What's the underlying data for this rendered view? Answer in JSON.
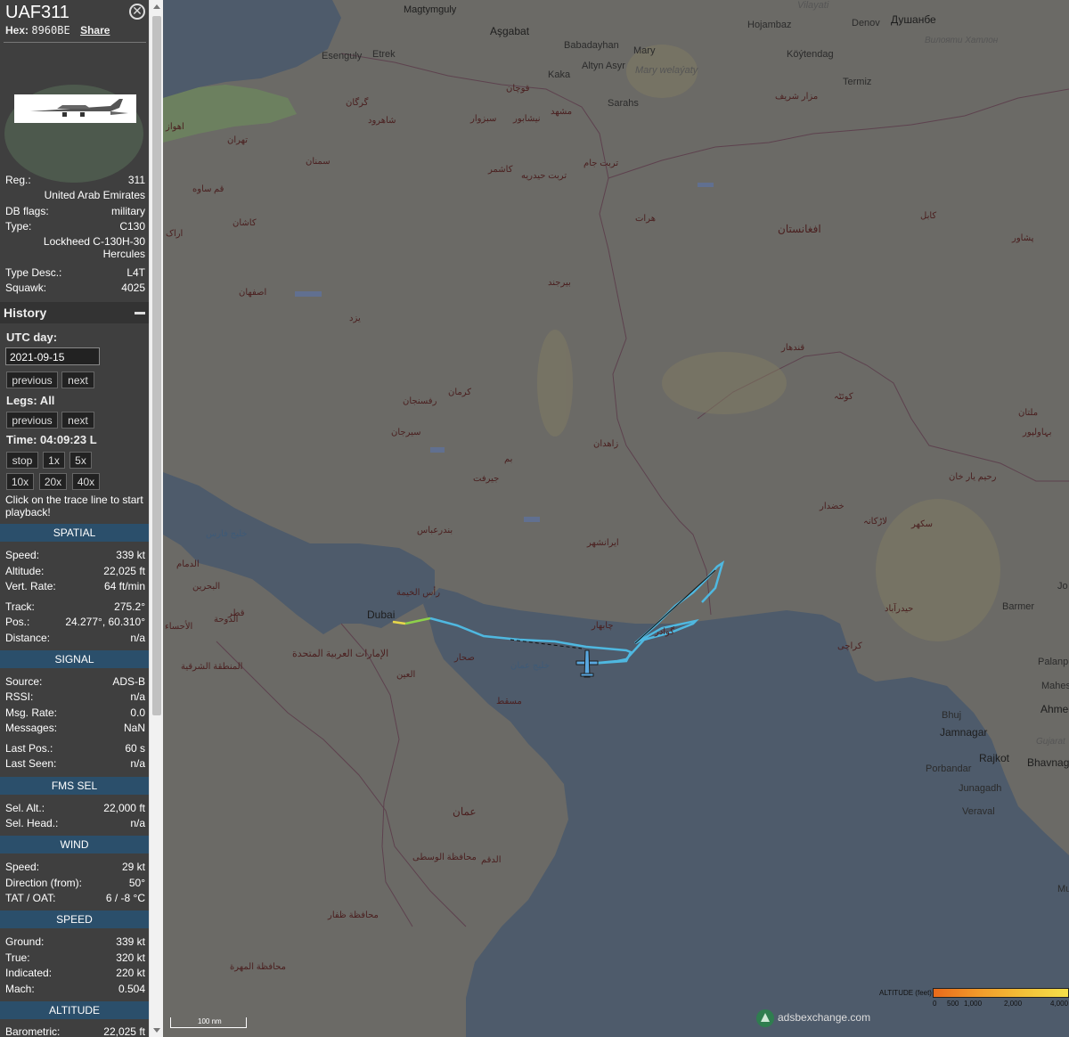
{
  "aircraft": {
    "callsign": "UAF311",
    "hex_label": "Hex:",
    "hex": "8960BE",
    "share_label": "Share",
    "close_symbol": "✕"
  },
  "info": [
    {
      "key": "Reg.:",
      "value": "311"
    },
    {
      "key": "",
      "value": "United Arab Emirates"
    },
    {
      "key": "DB flags:",
      "value": "military"
    },
    {
      "key": "Type:",
      "value": "C130"
    },
    {
      "key": "",
      "value": "Lockheed C-130H-30"
    },
    {
      "key": "",
      "value": "Hercules"
    },
    {
      "key": "Type Desc.:",
      "value": "L4T"
    },
    {
      "key": "Squawk:",
      "value": "4025"
    }
  ],
  "history": {
    "title": "History",
    "utc_day_label": "UTC day:",
    "date": "2021-09-15",
    "previous": "previous",
    "next": "next",
    "legs_label": "Legs: All",
    "time_label": "Time: 04:09:23 L",
    "stop": "stop",
    "x1": "1x",
    "x5": "5x",
    "x10": "10x",
    "x20": "20x",
    "x40": "40x",
    "note": "Click on the trace line to start playback!"
  },
  "sections": {
    "spatial": "SPATIAL",
    "signal": "SIGNAL",
    "fms": "FMS SEL",
    "wind": "WIND",
    "speed": "SPEED",
    "altitude": "ALTITUDE"
  },
  "spatial": [
    {
      "key": "Speed:",
      "value": "339 kt"
    },
    {
      "key": "Altitude:",
      "value": "22,025 ft"
    },
    {
      "key": "Vert. Rate:",
      "value": "64 ft/min"
    },
    {
      "key": "Track:",
      "value": "275.2°"
    },
    {
      "key": "Pos.:",
      "value": "24.277°, 60.310°"
    },
    {
      "key": "Distance:",
      "value": "n/a"
    }
  ],
  "signal": [
    {
      "key": "Source:",
      "value": "ADS-B"
    },
    {
      "key": "RSSI:",
      "value": "n/a"
    },
    {
      "key": "Msg. Rate:",
      "value": "0.0"
    },
    {
      "key": "Messages:",
      "value": "NaN"
    },
    {
      "key": "Last Pos.:",
      "value": "60 s"
    },
    {
      "key": "Last Seen:",
      "value": "n/a"
    }
  ],
  "fms": [
    {
      "key": "Sel. Alt.:",
      "value": "22,000 ft"
    },
    {
      "key": "Sel. Head.:",
      "value": "n/a"
    }
  ],
  "wind": [
    {
      "key": "Speed:",
      "value": "29 kt"
    },
    {
      "key": "Direction (from):",
      "value": "50°"
    },
    {
      "key": "TAT / OAT:",
      "value": "6 / -8 °C"
    }
  ],
  "speed": [
    {
      "key": "Ground:",
      "value": "339 kt"
    },
    {
      "key": "True:",
      "value": "320 kt"
    },
    {
      "key": "Indicated:",
      "value": "220 kt"
    },
    {
      "key": "Mach:",
      "value": "0.504"
    }
  ],
  "altitude": [
    {
      "key": "Barometric:",
      "value": "22,025 ft"
    }
  ],
  "map": {
    "places": [
      {
        "name": "Magtymguly"
      },
      {
        "name": "Aşgabat"
      },
      {
        "name": "Babadayhan"
      },
      {
        "name": "Mary"
      },
      {
        "name": "Altyn Asyr"
      },
      {
        "name": "Mary welaýaty"
      },
      {
        "name": "Hojambaz"
      },
      {
        "name": "Denov"
      },
      {
        "name": "Душанбе"
      },
      {
        "name": "Köýtendag"
      },
      {
        "name": "Esenguly"
      },
      {
        "name": "Etrek"
      },
      {
        "name": "Kaka"
      },
      {
        "name": "Sarahs"
      },
      {
        "name": "Termiz"
      },
      {
        "name": "Vilayati"
      },
      {
        "name": "Вилояти Хатлон"
      },
      {
        "name": "Dubai"
      },
      {
        "name": "Barmer"
      },
      {
        "name": "Palanpur"
      },
      {
        "name": "Mahesana"
      },
      {
        "name": "Ahmed"
      },
      {
        "name": "Bhuj"
      },
      {
        "name": "Jamnagar"
      },
      {
        "name": "Rajkot"
      },
      {
        "name": "Bhavnaga"
      },
      {
        "name": "Gujarat"
      },
      {
        "name": "Porbandar"
      },
      {
        "name": "Junagadh"
      },
      {
        "name": "Veraval"
      },
      {
        "name": "Mu"
      },
      {
        "name": "Jo"
      }
    ],
    "arabic_places": [
      {
        "name": "تهران"
      },
      {
        "name": "گرگان"
      },
      {
        "name": "مشهد"
      },
      {
        "name": "قوچان"
      },
      {
        "name": "سبزوار"
      },
      {
        "name": "نیشابور"
      },
      {
        "name": "سمنان"
      },
      {
        "name": "شاهرود"
      },
      {
        "name": "کاشمر"
      },
      {
        "name": "تربت جام"
      },
      {
        "name": "تربت حیدریه"
      },
      {
        "name": "قم"
      },
      {
        "name": "ساوه"
      },
      {
        "name": "اراک"
      },
      {
        "name": "کاشان"
      },
      {
        "name": "اصفهان"
      },
      {
        "name": "یزد"
      },
      {
        "name": "بیرجند"
      },
      {
        "name": "کرمان"
      },
      {
        "name": "رفسنجان"
      },
      {
        "name": "سیرجان"
      },
      {
        "name": "بم"
      },
      {
        "name": "جیرفت"
      },
      {
        "name": "زاهدان"
      },
      {
        "name": "ایرانشهر"
      },
      {
        "name": "بندرعباس"
      },
      {
        "name": "چابهار"
      },
      {
        "name": "گوادر"
      },
      {
        "name": "کراچی"
      },
      {
        "name": "حیدرآباد"
      },
      {
        "name": "سکھر"
      },
      {
        "name": "لاڑکانہ"
      },
      {
        "name": "خضدار"
      },
      {
        "name": "کوئٹہ"
      },
      {
        "name": "قندهار"
      },
      {
        "name": "افغانستان"
      },
      {
        "name": "هرات"
      },
      {
        "name": "مزار شریف"
      },
      {
        "name": "کابل"
      },
      {
        "name": "پشاور"
      },
      {
        "name": "ملتان"
      },
      {
        "name": "بہاولپور"
      },
      {
        "name": "رحیم یار خان"
      },
      {
        "name": "الإمارات العربية المتحدة"
      },
      {
        "name": "العين"
      },
      {
        "name": "مسقط"
      },
      {
        "name": "عمان"
      },
      {
        "name": "الدقم"
      },
      {
        "name": "صحار"
      },
      {
        "name": "قطر"
      },
      {
        "name": "الدوحة"
      },
      {
        "name": "البحرين"
      },
      {
        "name": "الدمام"
      },
      {
        "name": "الأحساء"
      },
      {
        "name": "رأس الخيمة"
      },
      {
        "name": "خليج عمان"
      },
      {
        "name": "خليج فارس"
      },
      {
        "name": "محافظة الوسطى"
      },
      {
        "name": "محافظة ظفار"
      },
      {
        "name": "محافظة المهرة"
      },
      {
        "name": "المنطقة الشرقية"
      },
      {
        "name": "اهواز"
      }
    ],
    "scale_label": "100 nm",
    "legend_title": "ALTITUDE (feet)",
    "legend_ticks": [
      "0",
      "500",
      "1,000",
      "2,000",
      "4,000"
    ],
    "brand": "adsbexchange.com"
  },
  "colors": {
    "sidebar_bg": "#3f3f3f",
    "section_band": "#2b4f6b",
    "map_bg": "#6d6c68",
    "sea": "#4e5b6b",
    "trace_blue": "#4fb8e0",
    "trace_green": "#8ed14a",
    "trace_yellow": "#e8d84a",
    "plane": "#5aa8e0"
  }
}
